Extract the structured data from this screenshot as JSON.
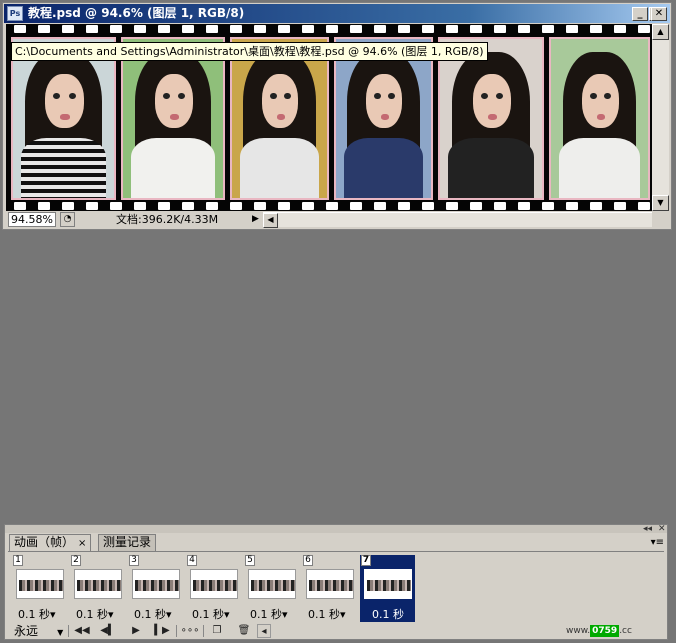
{
  "document_window": {
    "title": "教程.psd @ 94.6% (图层 1, RGB/8)",
    "app_icon": "photoshop-doc-icon",
    "minimize_label": "_",
    "maximize_label": "□",
    "close_label": "✕",
    "path_tooltip": "C:\\Documents and Settings\\Administrator\\桌面\\教程\\教程.psd @ 94.6% (图层 1, RGB/8)",
    "zoom_value": "94.58%",
    "doc_info": "文档:396.2K/4.33M",
    "photo_count": 6
  },
  "animation_panel": {
    "tabs": [
      {
        "label": "动画（帧）",
        "close": "×"
      },
      {
        "label": "测量记录"
      }
    ],
    "frames": [
      {
        "number": "1",
        "delay": "0.1 秒▾"
      },
      {
        "number": "2",
        "delay": "0.1 秒▾"
      },
      {
        "number": "3",
        "delay": "0.1 秒▾"
      },
      {
        "number": "4",
        "delay": "0.1 秒▾"
      },
      {
        "number": "5",
        "delay": "0.1 秒▾"
      },
      {
        "number": "6",
        "delay": "0.1 秒▾"
      },
      {
        "number": "7",
        "delay": "0.1 秒",
        "selected": true
      }
    ],
    "loop_option": "永远",
    "controls": [
      "first-frame-icon",
      "prev-frame-icon",
      "play-icon",
      "next-frame-icon",
      "tween-icon",
      "duplicate-frame-icon",
      "delete-frame-icon"
    ],
    "watermark_prefix": "www.",
    "watermark_brand": "0759",
    "watermark_suffix": ".cc"
  }
}
